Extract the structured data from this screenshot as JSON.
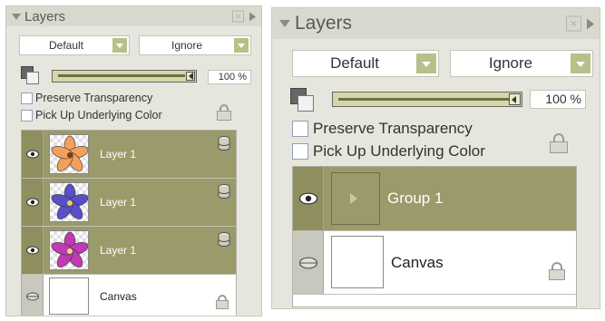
{
  "panels": [
    {
      "title": "Layers",
      "blend_mode": "Default",
      "composite_method": "Ignore",
      "opacity": "100 %",
      "preserve_transparency": "Preserve Transparency",
      "pick_up_color": "Pick Up Underlying Color",
      "layers": [
        {
          "name": "Layer 1",
          "visible": true,
          "selected": true,
          "flower_color": "#f2a05a"
        },
        {
          "name": "Layer 1",
          "visible": true,
          "selected": true,
          "flower_color": "#5a4fc8"
        },
        {
          "name": "Layer 1",
          "visible": true,
          "selected": true,
          "flower_color": "#c03ab4"
        },
        {
          "name": "Canvas",
          "visible": false,
          "selected": false
        }
      ]
    },
    {
      "title": "Layers",
      "blend_mode": "Default",
      "composite_method": "Ignore",
      "opacity": "100 %",
      "preserve_transparency": "Preserve Transparency",
      "pick_up_color": "Pick Up Underlying Color",
      "layers": [
        {
          "name": "Group 1",
          "visible": true,
          "selected": true
        },
        {
          "name": "Canvas",
          "visible": false,
          "selected": false
        }
      ]
    }
  ],
  "colors": {
    "selected_row": "#9a9a6a",
    "dropdown_button": "#b8c08a",
    "panel_bg": "#e6e6de"
  }
}
